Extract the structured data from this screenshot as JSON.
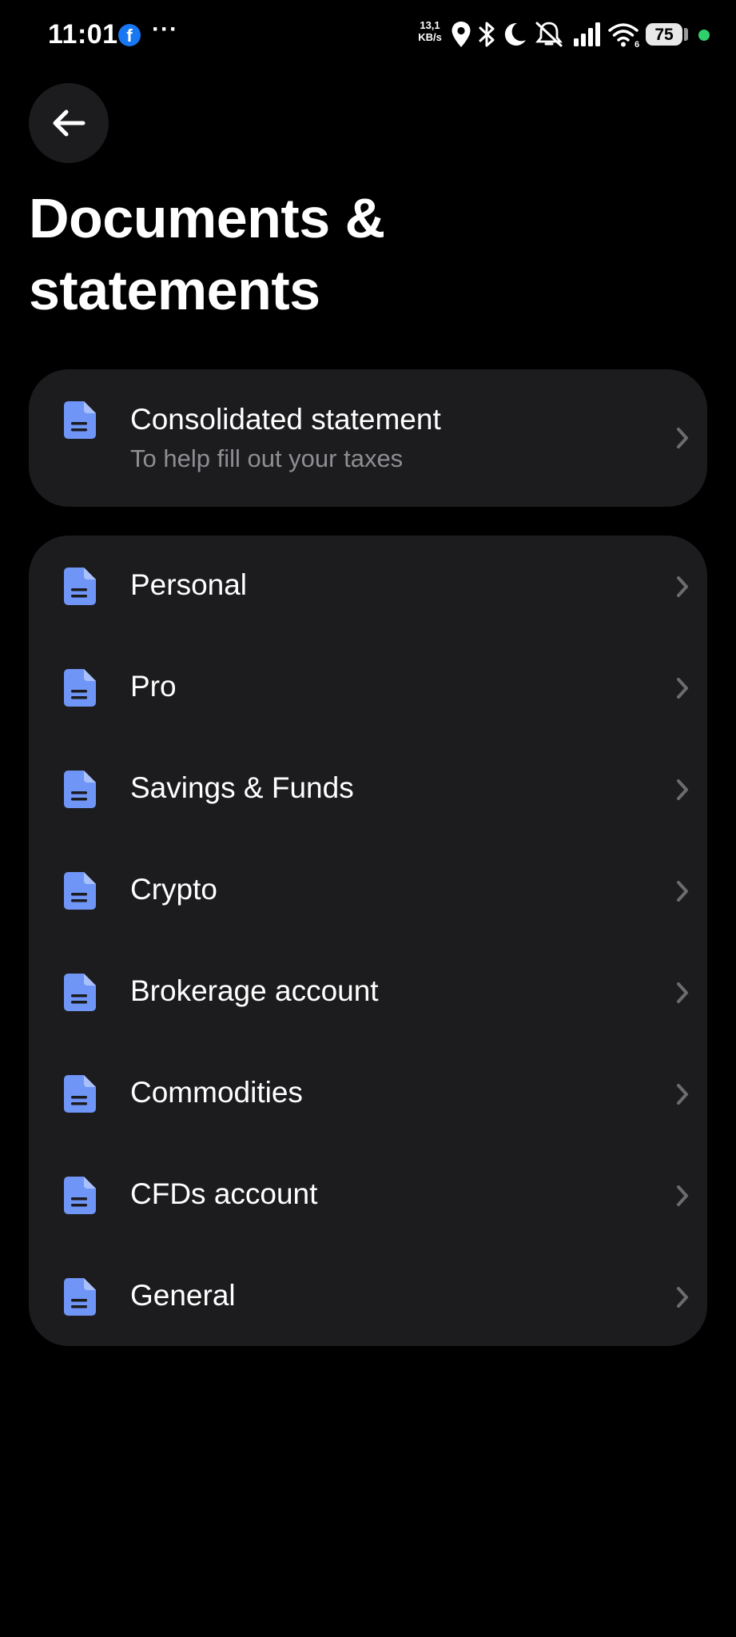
{
  "status_bar": {
    "time": "11:01",
    "notification_app": "f",
    "more": "···",
    "net_speed_value": "13,1",
    "net_speed_unit": "KB/s",
    "battery": "75",
    "icons": [
      "facebook-icon",
      "location-icon",
      "bluetooth-icon",
      "moon-icon",
      "bell-off-icon",
      "signal-icon",
      "wifi-icon",
      "battery-icon"
    ]
  },
  "header": {
    "back_icon": "arrow-left-icon",
    "title_line1": "Documents &",
    "title_line2": "statements"
  },
  "consolidated": {
    "title": "Consolidated statement",
    "subtitle": "To help fill out your taxes"
  },
  "accounts": {
    "items": [
      {
        "label": "Personal"
      },
      {
        "label": "Pro"
      },
      {
        "label": "Savings & Funds"
      },
      {
        "label": "Crypto"
      },
      {
        "label": "Brokerage account"
      },
      {
        "label": "Commodities"
      },
      {
        "label": "CFDs account"
      },
      {
        "label": "General"
      }
    ]
  },
  "colors": {
    "background": "#000000",
    "card": "#1c1c1e",
    "icon_accent": "#6f95f7",
    "subtitle": "#8e8e93",
    "chevron": "#6b6b70",
    "status_dot": "#2fcf6b"
  }
}
